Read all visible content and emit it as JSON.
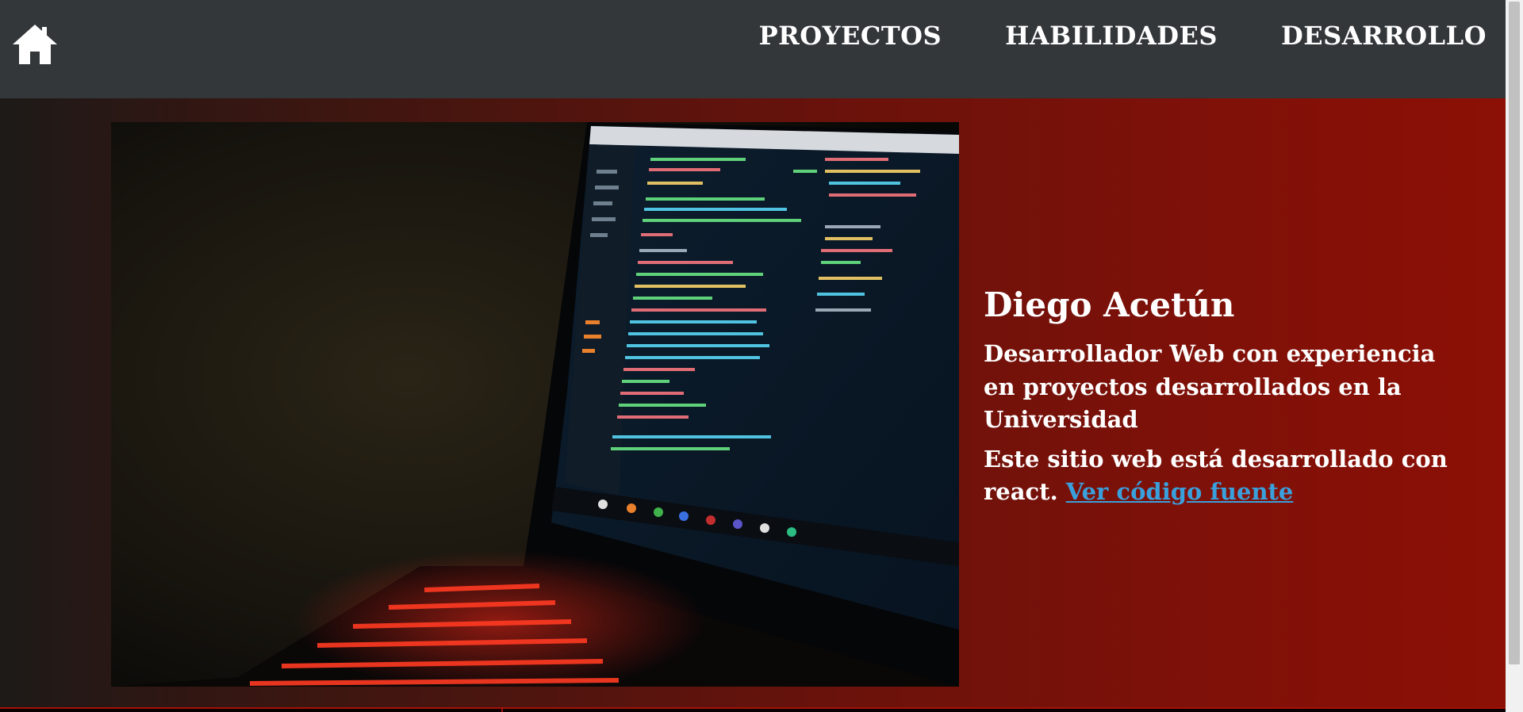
{
  "nav": {
    "home_icon": "home-icon",
    "links": [
      "PROYECTOS",
      "HABILIDADES",
      "DESARROLLO"
    ]
  },
  "hero": {
    "image_icon": "laptop-code-photo",
    "name": "Diego Acetún",
    "description": "Desarrollador Web con experiencia en proyectos desarrollados en la Universidad",
    "note_text": "Este sitio web está desarrollado con react. ",
    "source_link": "Ver código fuente"
  },
  "colors": {
    "navbar": "#33373a",
    "accent_red": "#8c1005",
    "link": "#3aa0dc"
  }
}
